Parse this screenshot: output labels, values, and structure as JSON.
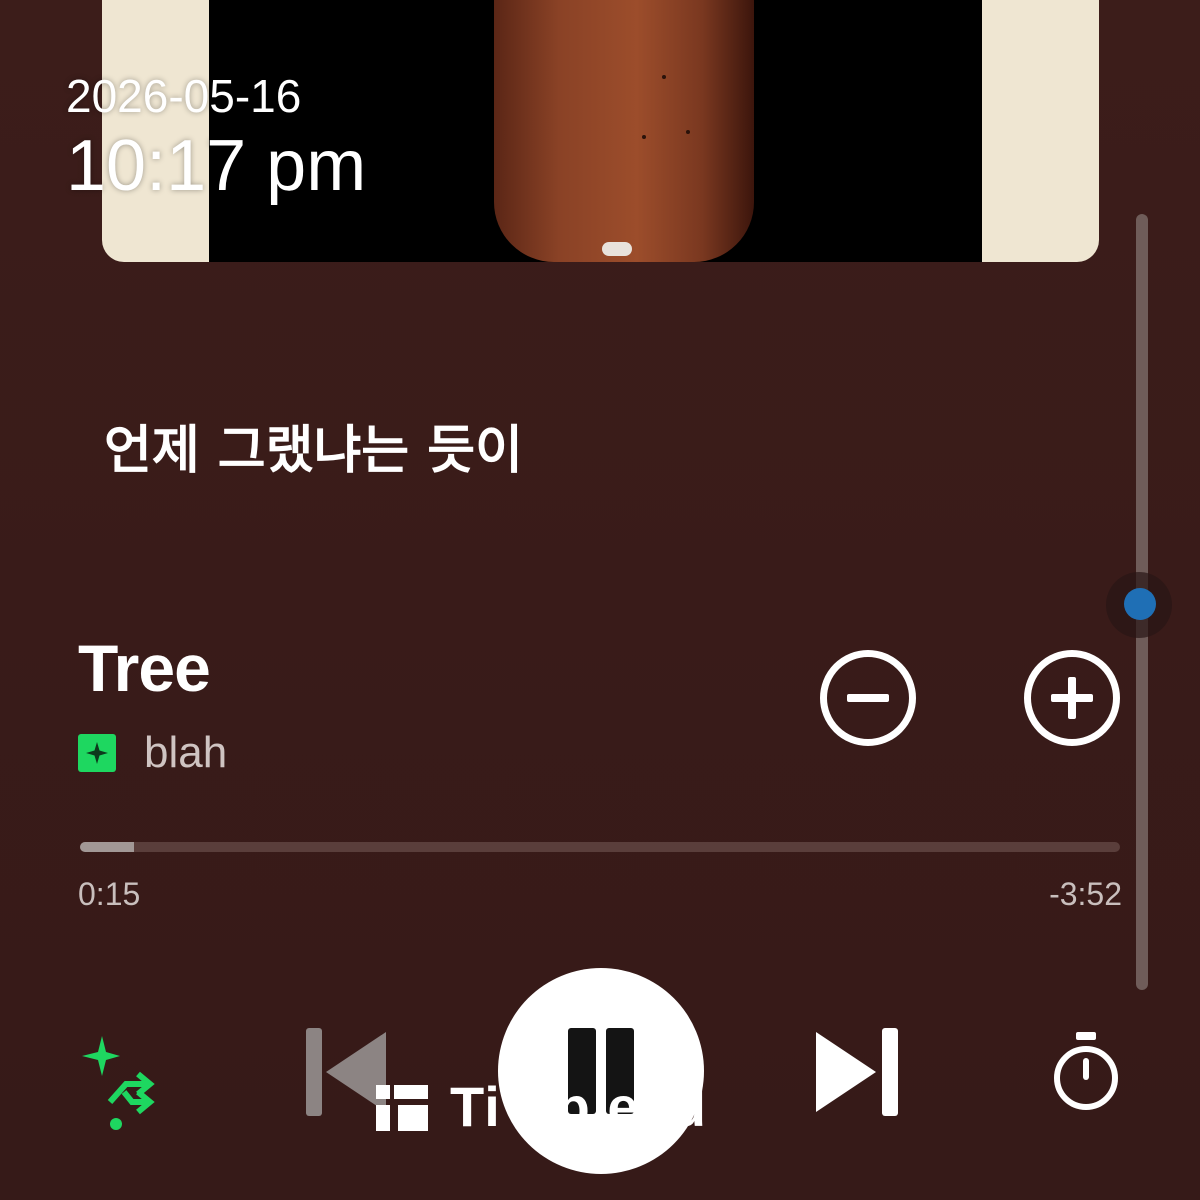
{
  "status": {
    "date": "2026-05-16",
    "time": "10:17 pm"
  },
  "lyrics": {
    "current_line": "언제 그랬냐는 듯이"
  },
  "track": {
    "title": "Tree",
    "artist": "blah"
  },
  "playback": {
    "elapsed": "0:15",
    "remaining": "-3:52",
    "progress_fraction": 0.0517,
    "volume_fraction": 0.5
  },
  "overlay": {
    "label": "Ti  Sp  ead"
  },
  "colors": {
    "background": "#3a1c1a",
    "accent_green": "#1ed760",
    "volume_knob": "#1f6fb5"
  },
  "icons": {
    "minus": "minus-circle-icon",
    "plus": "plus-circle-icon",
    "smart_shuffle": "smart-shuffle-icon",
    "previous": "skip-previous-icon",
    "pause": "pause-icon",
    "next": "skip-next-icon",
    "sleep_timer": "timer-icon",
    "badge": "sparkle-badge-icon"
  }
}
